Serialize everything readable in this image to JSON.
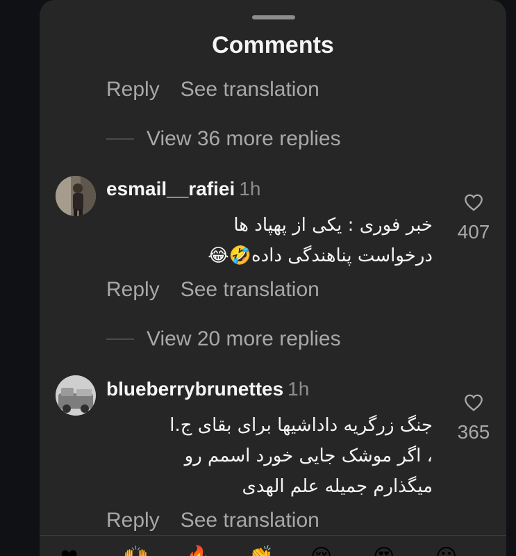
{
  "sheet": {
    "title": "Comments"
  },
  "top_actions": {
    "reply": "Reply",
    "translate": "See translation"
  },
  "replies_1": "View 36 more replies",
  "comments": [
    {
      "username": "esmail__rafiei",
      "time": "1h",
      "lines": [
        "خبر فوری : یکی از پهپاد ها",
        "درخواست پناهندگی داده🤣😂"
      ],
      "likes": "407",
      "reply": "Reply",
      "translate": "See translation"
    },
    {
      "username": "blueberrybrunettes",
      "time": "1h",
      "lines": [
        "جنگ زرگریه داداشیها برای بقای ج.ا",
        "، اگر موشک جایی خورد اسمم رو",
        "میگذارم جمیله علم الهدی"
      ],
      "likes": "365",
      "reply": "Reply",
      "translate": "See translation"
    }
  ],
  "replies_2": "View 20 more replies",
  "icons": {
    "like": "heart-outline-icon"
  },
  "colors": {
    "sheet_bg": "#262626",
    "text_primary": "#f5f5f5",
    "text_secondary": "#a8a8a8"
  }
}
